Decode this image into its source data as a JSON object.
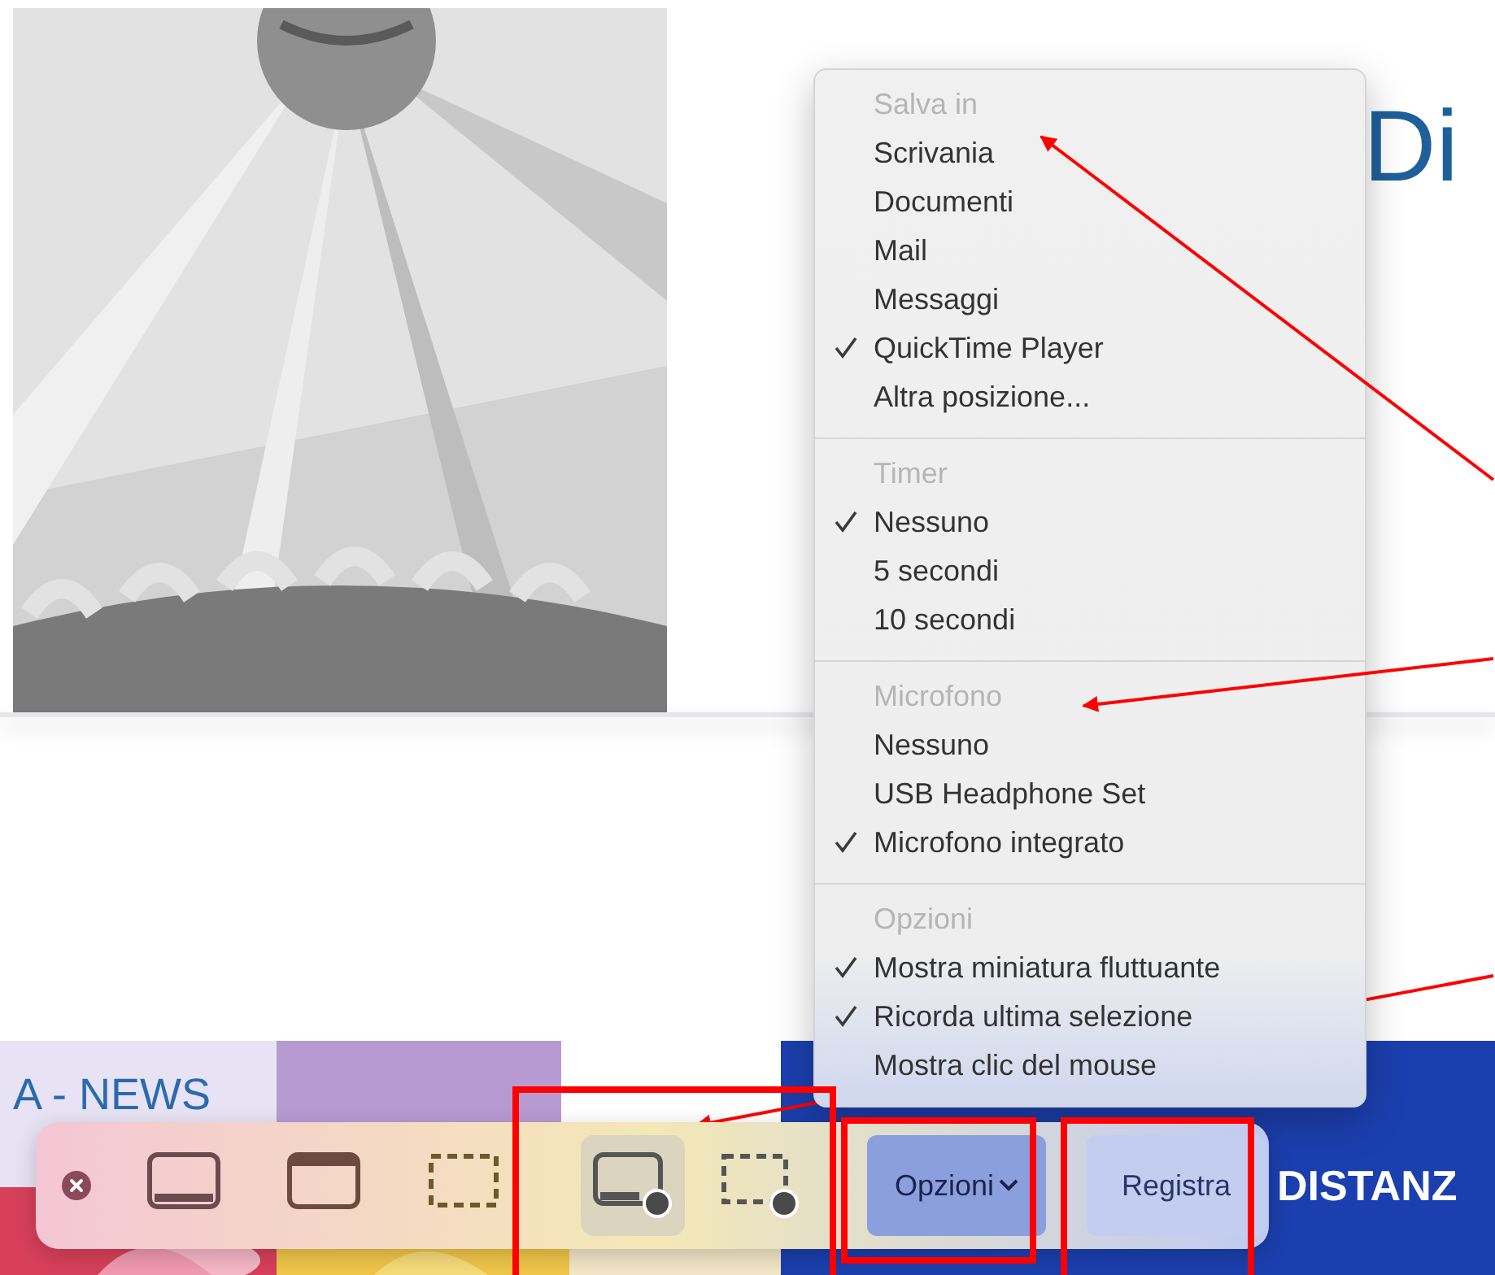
{
  "page": {
    "heading": "Di",
    "news_label": "A - NEWS",
    "banner_text": "DISTANZ"
  },
  "menu": {
    "sections": [
      {
        "header": "Salva in",
        "items": [
          {
            "label": "Scrivania",
            "checked": false
          },
          {
            "label": "Documenti",
            "checked": false
          },
          {
            "label": "Mail",
            "checked": false
          },
          {
            "label": "Messaggi",
            "checked": false
          },
          {
            "label": "QuickTime Player",
            "checked": true
          },
          {
            "label": "Altra posizione...",
            "checked": false
          }
        ]
      },
      {
        "header": "Timer",
        "items": [
          {
            "label": "Nessuno",
            "checked": true
          },
          {
            "label": "5 secondi",
            "checked": false
          },
          {
            "label": "10 secondi",
            "checked": false
          }
        ]
      },
      {
        "header": "Microfono",
        "items": [
          {
            "label": "Nessuno",
            "checked": false
          },
          {
            "label": "USB Headphone Set",
            "checked": false
          },
          {
            "label": "Microfono integrato",
            "checked": true
          }
        ]
      },
      {
        "header": "Opzioni",
        "items": [
          {
            "label": "Mostra miniatura fluttuante",
            "checked": true
          },
          {
            "label": "Ricorda ultima selezione",
            "checked": true
          },
          {
            "label": "Mostra clic del mouse",
            "checked": false
          }
        ]
      }
    ]
  },
  "toolbar": {
    "tools": [
      {
        "kind": "capture-screen",
        "selected": false
      },
      {
        "kind": "capture-window",
        "selected": false
      },
      {
        "kind": "capture-selection",
        "selected": false
      },
      {
        "kind": "record-screen",
        "selected": true
      },
      {
        "kind": "record-selection",
        "selected": false
      }
    ],
    "options_button": "Opzioni",
    "record_button": "Registra"
  }
}
